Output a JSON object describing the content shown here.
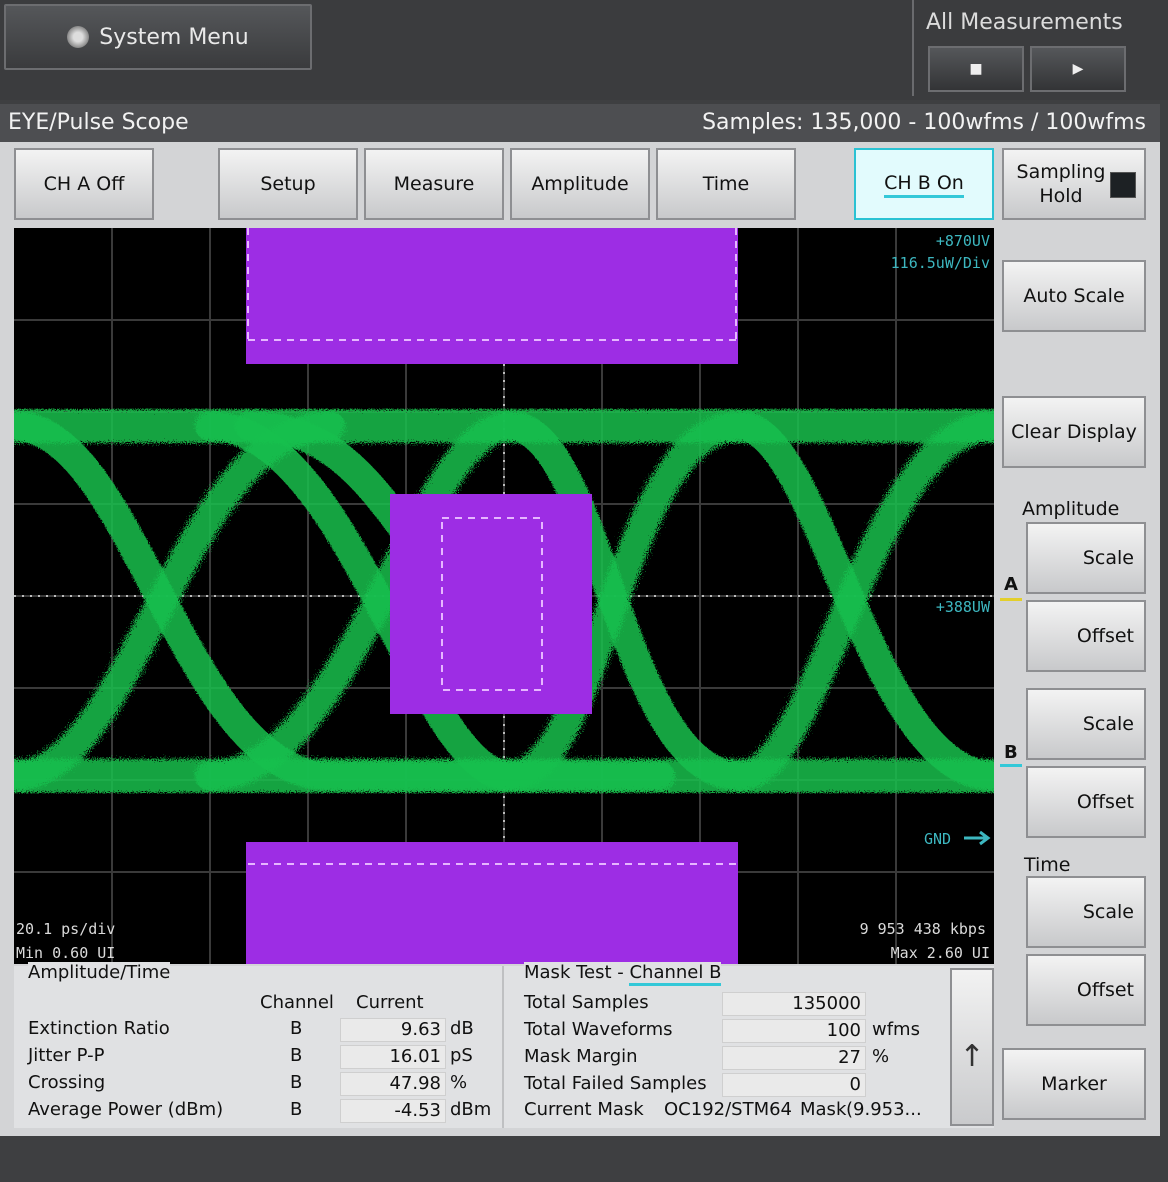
{
  "top": {
    "system_menu": "System Menu",
    "all_measurements": "All Measurements",
    "stop_symbol": "■",
    "play_symbol": "▶"
  },
  "window": {
    "title": "EYE/Pulse Scope",
    "samples": "Samples: 135,000 - 100wfms / 100wfms"
  },
  "toolbar": {
    "ch_a": "CH A Off",
    "setup": "Setup",
    "measure": "Measure",
    "amplitude": "Amplitude",
    "time": "Time",
    "ch_b": "CH B On",
    "sampling_hold": "Sampling Hold"
  },
  "side": {
    "auto_scale": "Auto Scale",
    "clear_display": "Clear Display",
    "amplitude_label": "Amplitude",
    "marker_a": "A",
    "marker_b": "B",
    "scale": "Scale",
    "offset": "Offset",
    "time_label": "Time",
    "marker": "Marker"
  },
  "scope": {
    "top_right_1": "+870UV",
    "top_right_2": "116.5uW/Div",
    "mid_right": "+388UW",
    "gnd": "GND",
    "time_div": "20.1 ps/div",
    "min_ui": "Min 0.60 UI",
    "bitrate": "9 953 438 kbps",
    "max_ui": "Max 2.60 UI",
    "colors": {
      "trace": "#18c04e",
      "mask": "#9d2de4",
      "grid": "#3c3c3c"
    }
  },
  "amp_time": {
    "title": "Amplitude/Time",
    "col_channel": "Channel",
    "col_current": "Current",
    "rows": [
      {
        "name": "Extinction Ratio",
        "channel": "B",
        "value": "9.63",
        "unit": "dB"
      },
      {
        "name": "Jitter P-P",
        "channel": "B",
        "value": "16.01",
        "unit": "pS"
      },
      {
        "name": "Crossing",
        "channel": "B",
        "value": "47.98",
        "unit": "%"
      },
      {
        "name": "Average Power (dBm)",
        "channel": "B",
        "value": "-4.53",
        "unit": "dBm"
      }
    ]
  },
  "mask_test": {
    "title_prefix": "Mask Test - ",
    "title_channel": "Channel B",
    "rows": [
      {
        "name": "Total Samples",
        "value": "135000",
        "unit": ""
      },
      {
        "name": "Total Waveforms",
        "value": "100",
        "unit": "wfms"
      },
      {
        "name": "Mask Margin",
        "value": "27",
        "unit": "%"
      },
      {
        "name": "Total Failed Samples",
        "value": "0",
        "unit": ""
      }
    ],
    "current_mask_label": "Current Mask",
    "current_mask_value": "OC192/STM64",
    "mask_label": "Mask",
    "mask_value": "(9.953..."
  },
  "scroll_arrow": "↑"
}
